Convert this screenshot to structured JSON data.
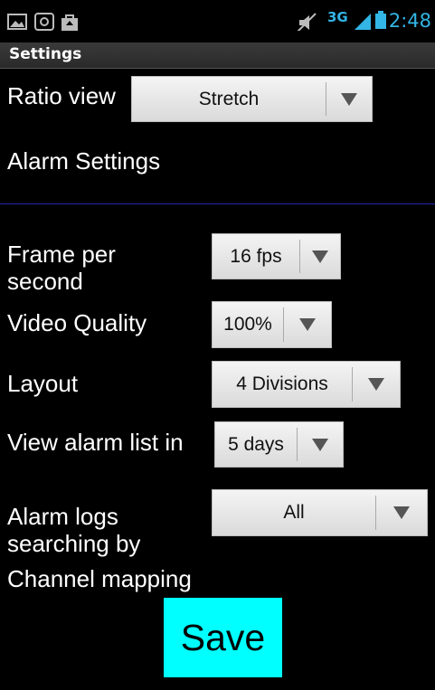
{
  "status_bar": {
    "time": "2:48",
    "network_label": "3G",
    "icons": [
      "image-icon",
      "at-icon",
      "bag-icon",
      "mute-icon",
      "network-icon",
      "signal-icon",
      "battery-icon"
    ],
    "time_color": "#33b5e5"
  },
  "header": {
    "title": "Settings"
  },
  "settings": {
    "ratio_view": {
      "label": "Ratio view",
      "value": "Stretch"
    },
    "alarm_settings_heading": "Alarm Settings",
    "frame_per_second": {
      "label": "Frame per second",
      "value": "16 fps"
    },
    "video_quality": {
      "label": "Video Quality",
      "value": "100%"
    },
    "layout": {
      "label": "Layout",
      "value": "4 Divisions"
    },
    "view_alarm_list": {
      "label": "View alarm list in",
      "value": "5 days"
    },
    "alarm_logs_searching": {
      "label": "Alarm logs searching by",
      "value": "All"
    },
    "channel_mapping": {
      "label": "Channel mapping"
    }
  },
  "save_button": {
    "label": "Save",
    "color": "#00ffff"
  },
  "colors": {
    "background": "#000000",
    "divider": "#2228aa"
  }
}
